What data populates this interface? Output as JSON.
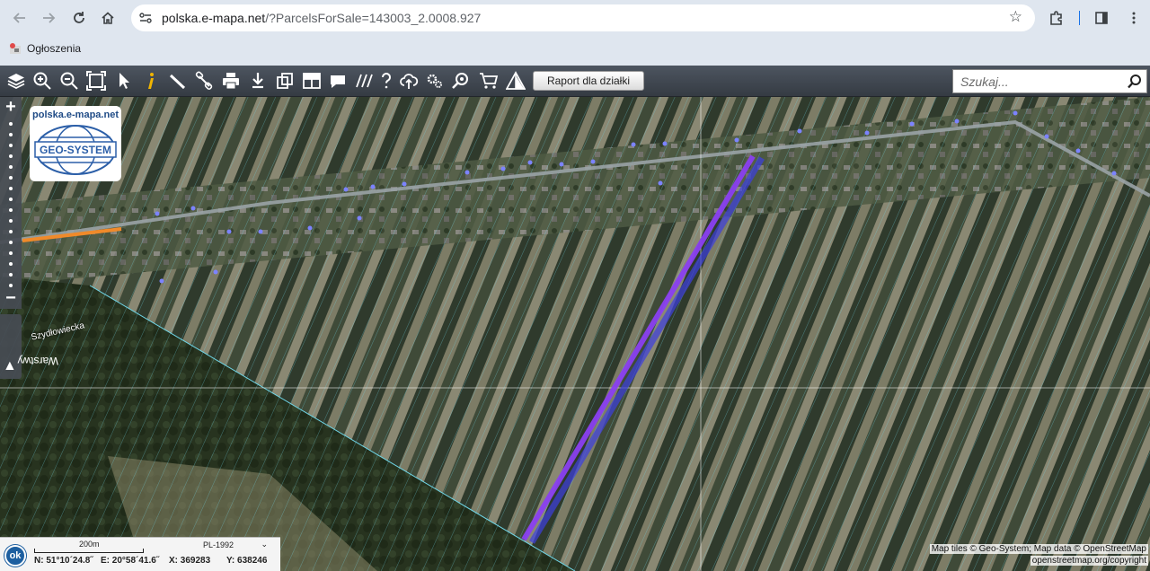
{
  "browser": {
    "url_host": "polska.e-mapa.net",
    "url_path": "/?ParcelsForSale=143003_2.0008.927",
    "bookmark_label": "Ogłoszenia"
  },
  "toolbar": {
    "tools": [
      "layers-icon",
      "zoom-in-icon",
      "zoom-out-icon",
      "zoom-extent-icon",
      "select-arrow-icon",
      "info-icon",
      "measure-ruler-icon",
      "link-icon",
      "print-icon",
      "download-icon",
      "copy-icon",
      "layout-icon",
      "comment-icon",
      "hatch-icon",
      "help-icon",
      "cloud-upload-icon",
      "settings-icon",
      "locate-icon",
      "cart-icon",
      "triangle-warning-icon"
    ],
    "report_label": "Raport dla działki",
    "search_placeholder": "Szukaj..."
  },
  "map": {
    "logo_url": "polska.e-mapa.net",
    "logo_brand": "GEO-SYSTEM",
    "street_name": "Szydłowiecka",
    "layers_label": "Warstwy",
    "parcel_color": "#8a3ff0"
  },
  "status": {
    "ok_label": "ok",
    "scale_label": "200m",
    "crs": "PL-1992",
    "lat": "N: 51°10´24.8˝",
    "lon": "E: 20°58´41.6˝",
    "x": "X: 369283",
    "y": "Y: 638246"
  },
  "attribution": {
    "line1": "Map tiles © Geo-System; Map data © OpenStreetMap",
    "line2": "openstreetmap.org/copyright"
  }
}
